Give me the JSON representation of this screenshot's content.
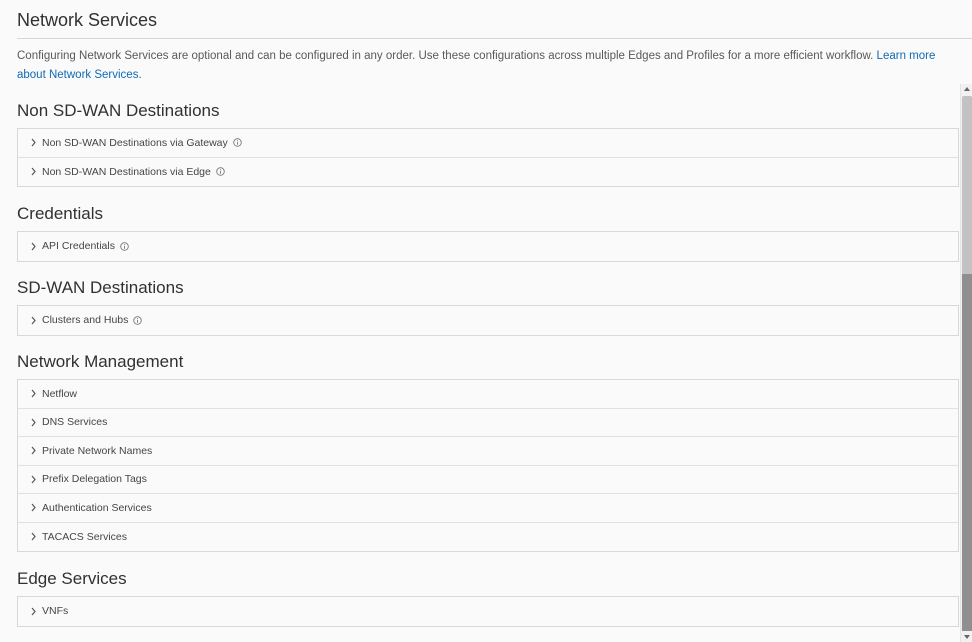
{
  "page": {
    "title": "Network Services",
    "intro_text": "Configuring Network Services are optional and can be configured in any order. Use these configurations across multiple Edges and Profiles for a more efficient workflow. ",
    "intro_link": "Learn more about Network Services."
  },
  "sections": {
    "non_sdwan": {
      "title": "Non SD-WAN Destinations",
      "items": [
        "Non SD-WAN Destinations via Gateway",
        "Non SD-WAN Destinations via Edge"
      ]
    },
    "credentials": {
      "title": "Credentials",
      "items": [
        "API Credentials"
      ]
    },
    "sdwan": {
      "title": "SD-WAN Destinations",
      "items": [
        "Clusters and Hubs"
      ]
    },
    "network_management": {
      "title": "Network Management",
      "items": [
        "Netflow",
        "DNS Services",
        "Private Network Names",
        "Prefix Delegation Tags",
        "Authentication Services",
        "TACACS Services"
      ]
    },
    "edge_services": {
      "title": "Edge Services",
      "items": [
        "VNFs"
      ]
    }
  },
  "colors": {
    "link": "#0f6ab5",
    "background": "#fafafa",
    "border": "#d8d8d8"
  },
  "icons": {
    "expand": "chevron-right-icon",
    "info": "info-circle-icon"
  }
}
